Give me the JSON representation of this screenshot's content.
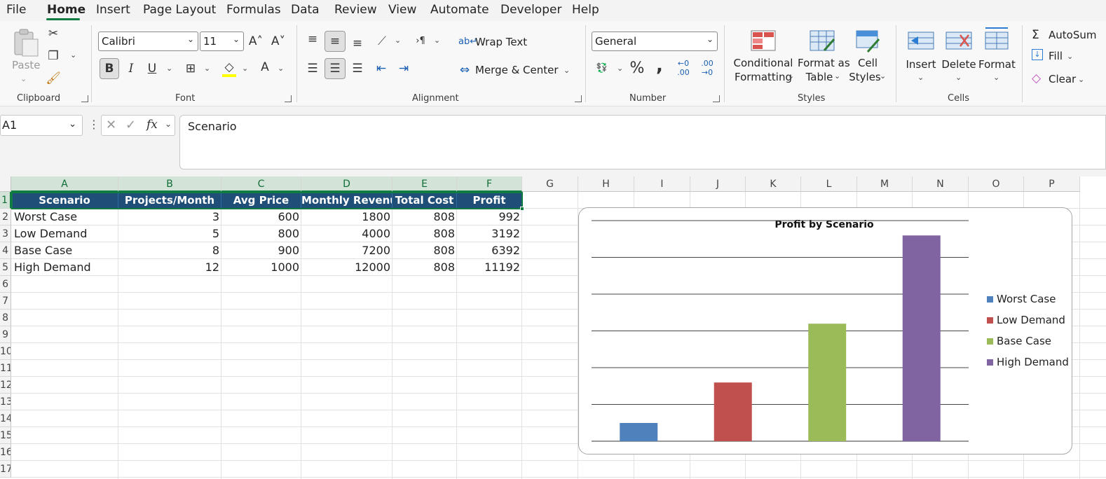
{
  "menu": {
    "items": [
      "File",
      "Home",
      "Insert",
      "Page Layout",
      "Formulas",
      "Data",
      "Review",
      "View",
      "Automate",
      "Developer",
      "Help"
    ],
    "active": "Home"
  },
  "ribbon": {
    "clipboard": {
      "paste": "Paste",
      "label": "Clipboard"
    },
    "font": {
      "name": "Calibri",
      "size": "11",
      "label": "Font",
      "bold": "B",
      "italic": "I",
      "underline": "U"
    },
    "alignment": {
      "wrap_text": "Wrap Text",
      "merge_center": "Merge & Center",
      "label": "Alignment"
    },
    "number": {
      "format": "General",
      "percent": "%",
      "comma": ",",
      "label": "Number"
    },
    "styles": {
      "conditional_1": "Conditional",
      "conditional_2": "Formatting",
      "format_table_1": "Format as",
      "format_table_2": "Table",
      "cell_styles_1": "Cell",
      "cell_styles_2": "Styles",
      "label": "Styles"
    },
    "cells": {
      "insert": "Insert",
      "delete": "Delete",
      "format": "Format",
      "label": "Cells"
    },
    "editing": {
      "autosum": "AutoSum",
      "fill": "Fill",
      "clear": "Clear"
    }
  },
  "formula_bar": {
    "name_box": "A1",
    "fx": "fx",
    "content": "Scenario"
  },
  "sheet": {
    "columns": [
      "A",
      "B",
      "C",
      "D",
      "E",
      "F",
      "G",
      "H",
      "I",
      "J",
      "K",
      "L",
      "M",
      "N",
      "O",
      "P"
    ],
    "rows": [
      "1",
      "2",
      "3",
      "4",
      "5",
      "6",
      "7",
      "8",
      "9",
      "10",
      "11",
      "12",
      "13",
      "14",
      "15",
      "16",
      "17"
    ],
    "headers": [
      "Scenario",
      "Projects/Month",
      "Avg Price",
      "Monthly Revenue",
      "Total Cost",
      "Profit"
    ],
    "data": [
      [
        "Worst Case",
        "3",
        "600",
        "1800",
        "808",
        "992"
      ],
      [
        "Low Demand",
        "5",
        "800",
        "4000",
        "808",
        "3192"
      ],
      [
        "Base Case",
        "8",
        "900",
        "7200",
        "808",
        "6392"
      ],
      [
        "High Demand",
        "12",
        "1000",
        "12000",
        "808",
        "11192"
      ]
    ]
  },
  "chart_data": {
    "type": "bar",
    "title": "Profit by Scenario",
    "categories": [
      "Worst Case",
      "Low Demand",
      "Base Case",
      "High Demand"
    ],
    "values": [
      992,
      3192,
      6392,
      11192
    ],
    "colors": [
      "#4f81bd",
      "#c0504d",
      "#9bbb59",
      "#8064a2"
    ],
    "legend": "right",
    "grid": true,
    "ylim": [
      0,
      12000
    ]
  }
}
